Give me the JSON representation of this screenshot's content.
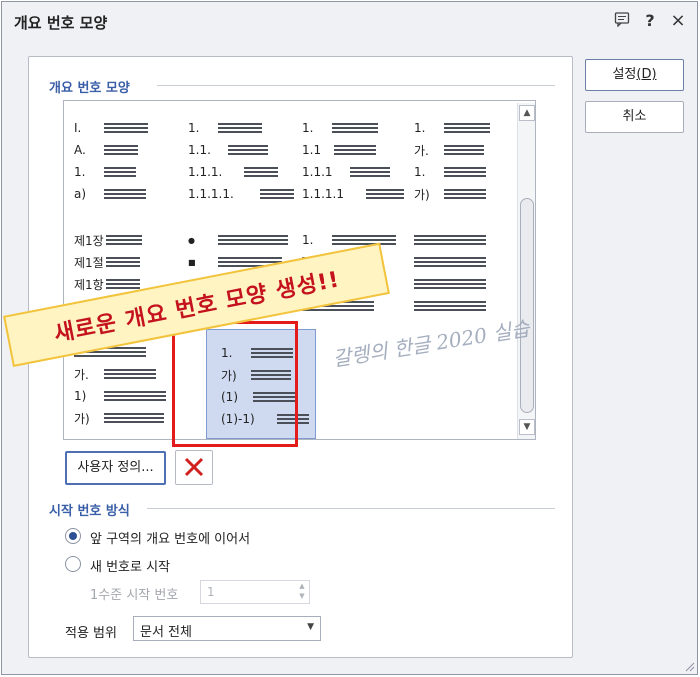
{
  "dialog": {
    "title": "개요 번호 모양",
    "icons": [
      "comment-icon",
      "help-icon",
      "close-icon"
    ],
    "help_glyph": "?",
    "close_glyph": "×"
  },
  "section_shapes": {
    "title": "개요 번호 모양"
  },
  "styles": [
    {
      "rows": [
        "I.",
        "A.",
        "1.",
        "a)"
      ]
    },
    {
      "rows": [
        "1.",
        "1.1.",
        "1.1.1.",
        "1.1.1.1."
      ]
    },
    {
      "rows": [
        "1.",
        "1.1",
        "1.1.1",
        "1.1.1.1"
      ]
    },
    {
      "rows": [
        "1.",
        "가.",
        "1.",
        "가)"
      ]
    },
    {
      "rows": [
        "제1장",
        "제1절",
        "제1항",
        "–"
      ]
    },
    {
      "rows": [
        "●",
        "■",
        "▶",
        ""
      ]
    },
    {
      "rows": [
        "1.",
        "",
        "",
        ""
      ]
    },
    {
      "rows": [
        "",
        "",
        "",
        ""
      ]
    },
    {
      "rows": [
        "",
        "가.",
        "1)",
        "가)"
      ]
    },
    {
      "rows": [
        "1.",
        "가)",
        "(1)",
        "(1)-1)"
      ],
      "selected": true
    }
  ],
  "overlay": {
    "banner": "새로운 개요 번호 모양 생성!!",
    "watermark": "갈렝의 한글 2020 실습"
  },
  "buttons": {
    "custom_label": "사용자 정의...",
    "ok_label": "설정",
    "ok_hotkey": "(D)",
    "cancel_label": "취소"
  },
  "section_start": {
    "title": "시작 번호 방식",
    "option_continue": "앞 구역의 개요 번호에 이어서",
    "option_new": "새 번호로 시작",
    "level1_label": "1수준 시작 번호",
    "level1_value": "1",
    "continue_selected": true
  },
  "scope": {
    "label": "적용 범위",
    "value": "문서 전체"
  },
  "colors": {
    "accent": "#3a5fa8",
    "highlight_red": "#e31b1b",
    "selected_bg": "#cfdaf1"
  }
}
